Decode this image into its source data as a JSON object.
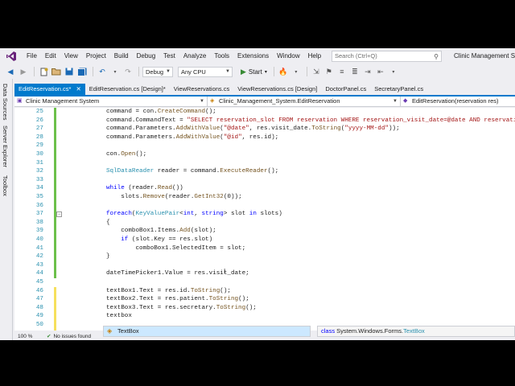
{
  "menu": {
    "items": [
      "File",
      "Edit",
      "View",
      "Project",
      "Build",
      "Debug",
      "Test",
      "Analyze",
      "Tools",
      "Extensions",
      "Window",
      "Help"
    ],
    "search_placeholder": "Search (Ctrl+Q)",
    "app_title": "Clinic Management Sy"
  },
  "toolbar": {
    "config": "Debug",
    "platform": "Any CPU",
    "start_label": "Start"
  },
  "side_tabs": [
    "Data Sources",
    "Server Explorer",
    "Toolbox"
  ],
  "doc_tabs": [
    {
      "label": "EditReservation.cs*",
      "active": true,
      "close": "✕"
    },
    {
      "label": "EditReservation.cs [Design]*",
      "active": false,
      "close": ""
    },
    {
      "label": "ViewReservations.cs",
      "active": false,
      "close": ""
    },
    {
      "label": "ViewReservations.cs [Design]",
      "active": false,
      "close": ""
    },
    {
      "label": "DoctorPanel.cs",
      "active": false,
      "close": ""
    },
    {
      "label": "SecretaryPanel.cs",
      "active": false,
      "close": ""
    }
  ],
  "navbar": {
    "project": "Clinic Management System",
    "class": "Clinic_Management_System.EditReservation",
    "member": "EditReservation(reservation res)"
  },
  "code_lines": [
    {
      "n": "25",
      "segs": [
        [
          "",
          "command = con."
        ],
        [
          "mt",
          "CreateCommand"
        ],
        [
          "",
          "();"
        ]
      ]
    },
    {
      "n": "26",
      "segs": [
        [
          "",
          "command.CommandText = "
        ],
        [
          "st",
          "\"SELECT reservation_slot FROM reservation WHERE reservation_visit_date=@date AND reservatio"
        ]
      ]
    },
    {
      "n": "27",
      "segs": [
        [
          "",
          "command.Parameters."
        ],
        [
          "mt",
          "AddWithValue"
        ],
        [
          "",
          "("
        ],
        [
          "st",
          "\"@date\""
        ],
        [
          "",
          ", res.visit_date."
        ],
        [
          "mt",
          "ToString"
        ],
        [
          "",
          "("
        ],
        [
          "st",
          "\"yyyy-MM-dd\""
        ],
        [
          "",
          "));"
        ]
      ]
    },
    {
      "n": "28",
      "segs": [
        [
          "",
          "command.Parameters."
        ],
        [
          "mt",
          "AddWithValue"
        ],
        [
          "",
          "("
        ],
        [
          "st",
          "\"@id\""
        ],
        [
          "",
          ", res.id);"
        ]
      ]
    },
    {
      "n": "29",
      "segs": []
    },
    {
      "n": "30",
      "segs": [
        [
          "",
          "con."
        ],
        [
          "mt",
          "Open"
        ],
        [
          "",
          "();"
        ]
      ]
    },
    {
      "n": "31",
      "segs": []
    },
    {
      "n": "32",
      "segs": [
        [
          "ty",
          "SqlDataReader"
        ],
        [
          "",
          " reader = command."
        ],
        [
          "mt",
          "ExecuteReader"
        ],
        [
          "",
          "();"
        ]
      ]
    },
    {
      "n": "33",
      "segs": []
    },
    {
      "n": "34",
      "segs": [
        [
          "kw",
          "while"
        ],
        [
          "",
          " (reader."
        ],
        [
          "mt",
          "Read"
        ],
        [
          "",
          "())"
        ]
      ]
    },
    {
      "n": "35",
      "segs": [
        [
          "",
          "    slots."
        ],
        [
          "mt",
          "Remove"
        ],
        [
          "",
          "(reader."
        ],
        [
          "mt",
          "GetInt32"
        ],
        [
          "",
          "(0));"
        ]
      ]
    },
    {
      "n": "36",
      "segs": []
    },
    {
      "n": "37",
      "segs": [
        [
          "kw",
          "foreach"
        ],
        [
          "",
          "("
        ],
        [
          "ty",
          "KeyValuePair"
        ],
        [
          "",
          "<"
        ],
        [
          "kw",
          "int"
        ],
        [
          "",
          ", "
        ],
        [
          "kw",
          "string"
        ],
        [
          "",
          "> slot "
        ],
        [
          "kw",
          "in"
        ],
        [
          "",
          " slots)"
        ]
      ]
    },
    {
      "n": "38",
      "segs": [
        [
          "",
          "{"
        ]
      ]
    },
    {
      "n": "39",
      "segs": [
        [
          "",
          "    comboBox1.Items."
        ],
        [
          "mt",
          "Add"
        ],
        [
          "",
          "(slot);"
        ]
      ]
    },
    {
      "n": "40",
      "segs": [
        [
          "",
          "    "
        ],
        [
          "kw",
          "if"
        ],
        [
          "",
          " (slot.Key == res.slot)"
        ]
      ]
    },
    {
      "n": "41",
      "segs": [
        [
          "",
          "        comboBox1.SelectedItem = slot;"
        ]
      ]
    },
    {
      "n": "42",
      "segs": [
        [
          "",
          "}"
        ]
      ]
    },
    {
      "n": "43",
      "segs": []
    },
    {
      "n": "44",
      "segs": [
        [
          "",
          "dateTimePicker1.Value = res.visit_date;"
        ]
      ]
    },
    {
      "n": "45",
      "segs": []
    },
    {
      "n": "46",
      "segs": [
        [
          "",
          "textBox1.Text = res.id."
        ],
        [
          "mt",
          "ToString"
        ],
        [
          "",
          "();"
        ]
      ]
    },
    {
      "n": "47",
      "segs": [
        [
          "",
          "textBox2.Text = res.patient."
        ],
        [
          "mt",
          "ToString"
        ],
        [
          "",
          "();"
        ]
      ]
    },
    {
      "n": "48",
      "segs": [
        [
          "",
          "textBox3.Text = res.secretary."
        ],
        [
          "mt",
          "ToString"
        ],
        [
          "",
          "();"
        ]
      ]
    },
    {
      "n": "49",
      "segs": [
        [
          "",
          "textbox"
        ]
      ]
    },
    {
      "n": "50",
      "segs": []
    }
  ],
  "intellisense": {
    "item": "TextBox",
    "tip_kw": "class",
    "tip_ns": " System.Windows.Forms.",
    "tip_type": "TextBox"
  },
  "status": {
    "zoom": "100 %",
    "issues": "No issues found"
  }
}
